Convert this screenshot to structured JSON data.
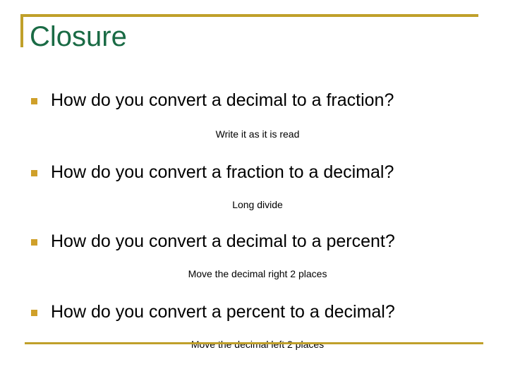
{
  "slide": {
    "title": "Closure",
    "colors": {
      "title_text": "#1a6b45",
      "rule_gold": "#c0a02a",
      "bullet_gold": "#cfa02a",
      "body_text": "#000000",
      "background": "#ffffff"
    },
    "items": [
      {
        "bullet": "How do you convert a decimal to a fraction?",
        "answer": "Write it as it is read"
      },
      {
        "bullet": "How do you convert a fraction to a decimal?",
        "answer": "Long divide"
      },
      {
        "bullet": "How do you convert a decimal to a percent?",
        "answer": "Move the decimal right 2 places"
      },
      {
        "bullet": "How do you convert a percent to a decimal?",
        "answer": "Move the decimal left 2 places"
      }
    ]
  }
}
